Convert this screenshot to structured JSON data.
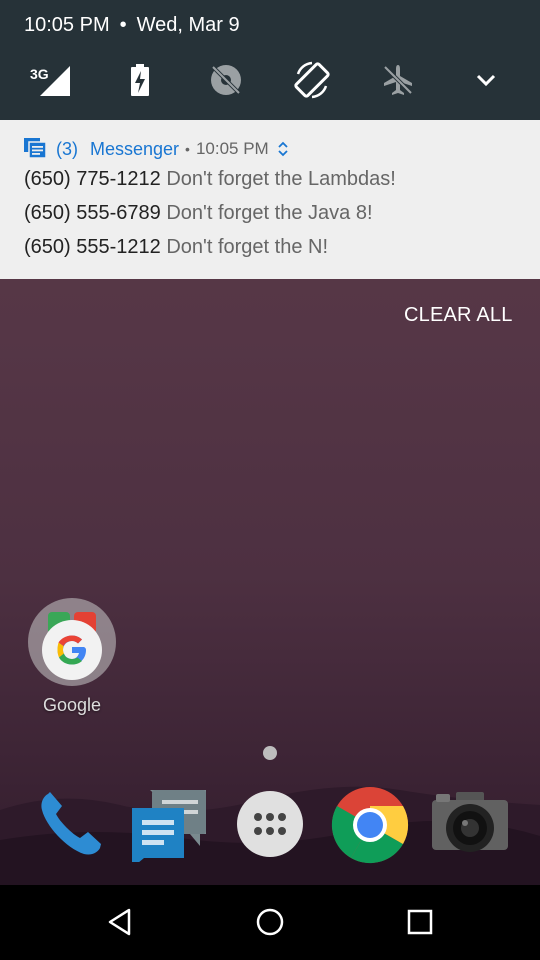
{
  "status": {
    "time": "10:05 PM",
    "separator": "•",
    "date": "Wed, Mar 9"
  },
  "quick_settings": [
    {
      "icon": "signal-3g-icon",
      "label": "3G"
    },
    {
      "icon": "battery-icon"
    },
    {
      "icon": "location-off-icon"
    },
    {
      "icon": "auto-rotate-icon"
    },
    {
      "icon": "airplane-mode-icon"
    },
    {
      "icon": "expand-chevron-icon"
    }
  ],
  "notification": {
    "count": "(3)",
    "app": "Messenger",
    "separator": "•",
    "time": "10:05 PM",
    "accent_color": "#1976d2",
    "messages": [
      {
        "sender": "(650) 775-1212",
        "text": "Don't forget the Lambdas!"
      },
      {
        "sender": "(650) 555-6789",
        "text": "Don't forget the Java 8!"
      },
      {
        "sender": "(650) 555-1212",
        "text": "Don't forget the N!"
      }
    ]
  },
  "clear_all": "CLEAR ALL",
  "home": {
    "folder_label": "Google",
    "dock": [
      "phone-icon",
      "messenger-icon",
      "app-drawer-icon",
      "chrome-icon",
      "camera-icon"
    ]
  },
  "navbar": [
    "back-icon",
    "home-icon",
    "recents-icon"
  ]
}
